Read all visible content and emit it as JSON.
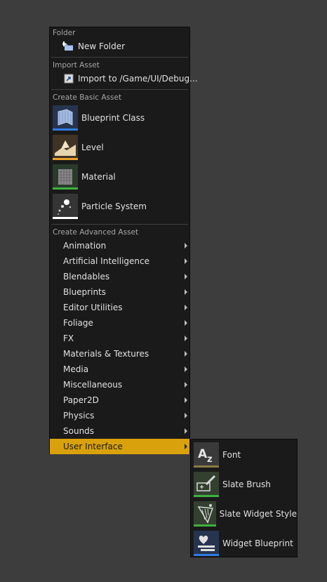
{
  "menu": {
    "sections": {
      "folder": "Folder",
      "import": "Import Asset",
      "basic": "Create Basic Asset",
      "advanced": "Create Advanced Asset"
    },
    "new_folder": "New Folder",
    "import_to": "Import to /Game/UI/Debug...",
    "basic_assets": [
      {
        "label": "Blueprint Class",
        "icon": "blueprint-class-icon",
        "color": "#2f7de1"
      },
      {
        "label": "Level",
        "icon": "level-icon",
        "color": "#e8a02a"
      },
      {
        "label": "Material",
        "icon": "material-icon",
        "color": "#3db13d"
      },
      {
        "label": "Particle System",
        "icon": "particle-system-icon",
        "color": "#ffffff"
      }
    ],
    "advanced_items": [
      "Animation",
      "Artificial Intelligence",
      "Blendables",
      "Blueprints",
      "Editor Utilities",
      "Foliage",
      "FX",
      "Materials & Textures",
      "Media",
      "Miscellaneous",
      "Paper2D",
      "Physics",
      "Sounds",
      "User Interface"
    ],
    "active_item": "User Interface",
    "highlight_color": "#d9a10b"
  },
  "submenu": {
    "items": [
      {
        "label": "Font",
        "icon": "font-icon",
        "color": "#8a7a44"
      },
      {
        "label": "Slate Brush",
        "icon": "slate-brush-icon",
        "color": "#3db13d"
      },
      {
        "label": "Slate Widget Style",
        "icon": "slate-widget-style-icon",
        "color": "#3db13d"
      },
      {
        "label": "Widget Blueprint",
        "icon": "widget-blueprint-icon",
        "color": "#2f7de1"
      }
    ]
  }
}
